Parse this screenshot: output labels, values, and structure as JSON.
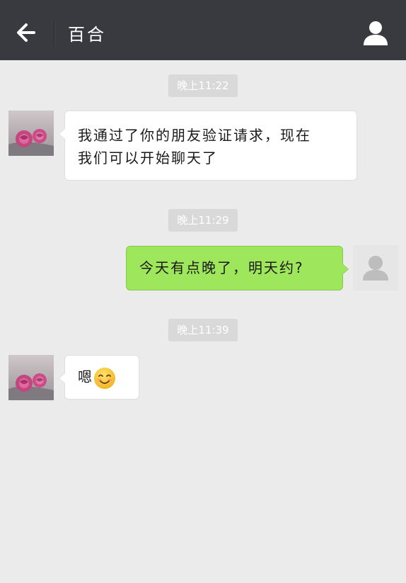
{
  "header": {
    "title": "百合",
    "back_icon": "back-arrow-icon",
    "profile_icon": "person-icon",
    "background": "#393a3f"
  },
  "chat": {
    "background": "#ebebeb",
    "messages": [
      {
        "kind": "timestamp",
        "text": "晚上11:22"
      },
      {
        "kind": "incoming",
        "line1": "我通过了你的朋友验证请求，现在",
        "line2": "我们可以开始聊天了",
        "avatar": "rose-avatar"
      },
      {
        "kind": "timestamp",
        "text": "晚上11:29"
      },
      {
        "kind": "outgoing",
        "text": "今天有点晚了，明天约?",
        "avatar": "default-user-avatar"
      },
      {
        "kind": "timestamp",
        "text": "晚上11:39"
      },
      {
        "kind": "incoming",
        "text": "嗯",
        "emoji": "smiling-face-emoji",
        "avatar": "rose-avatar"
      }
    ]
  },
  "colors": {
    "outgoing_bubble": "#9ee65c",
    "incoming_bubble": "#ffffff",
    "timestamp_bg": "#d9d9d9"
  }
}
